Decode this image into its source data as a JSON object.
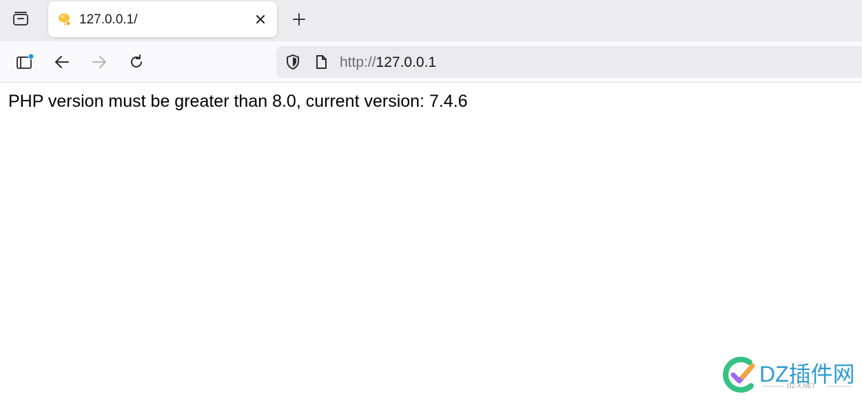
{
  "browser": {
    "tab": {
      "title": "127.0.0.1/"
    },
    "address": {
      "scheme": "http://",
      "host": "127.0.0.1"
    },
    "icons": {
      "tab_list": "tab-list-icon",
      "favicon": "bulb-favicon-icon",
      "close": "close-icon",
      "new_tab": "plus-icon",
      "sidebar": "sidebar-icon",
      "back": "back-arrow-icon",
      "forward": "forward-arrow-icon",
      "reload": "reload-icon",
      "shield": "shield-icon",
      "page": "page-icon"
    },
    "colors": {
      "tab_strip": "#ececee",
      "toolbar": "#f9f9fb",
      "urlbar": "#ebebef",
      "notification_dot": "#1a9bf0"
    }
  },
  "page": {
    "message": "PHP version must be greater than 8.0, current version: 7.4.6"
  },
  "watermark": {
    "title": "DZ插件网",
    "subtitle": "DZ-X.NET",
    "color": "#2f9bd3"
  }
}
